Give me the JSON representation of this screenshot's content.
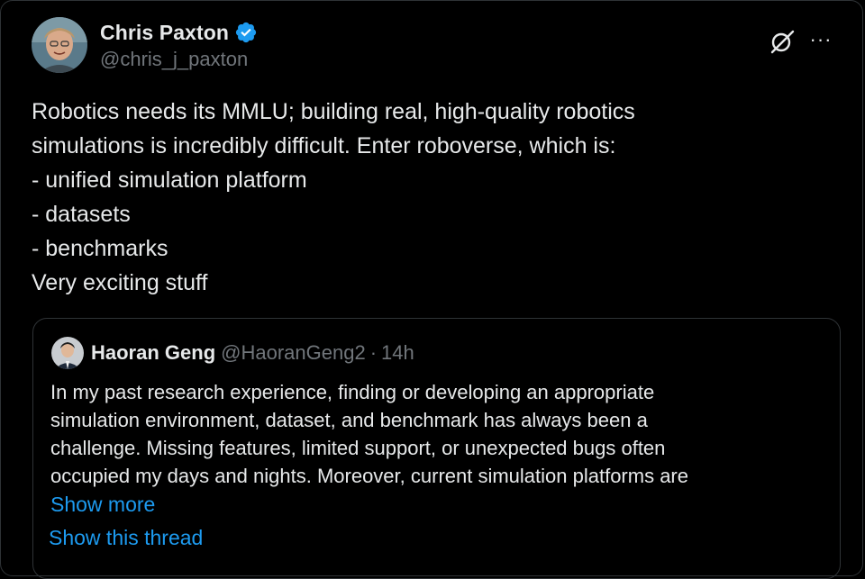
{
  "author": {
    "display_name": "Chris Paxton",
    "handle": "@chris_j_paxton",
    "avatar_icon": "avatar-photo",
    "verified_icon": "verified-badge-icon"
  },
  "actions": {
    "grok_icon": "grok-icon",
    "more_label": "···"
  },
  "tweet": {
    "lines": [
      "Robotics needs its MMLU; building real, high-quality robotics",
      "simulations is incredibly difficult. Enter roboverse, which is:",
      "- unified simulation platform",
      "- datasets",
      "- benchmarks",
      "Very exciting stuff"
    ]
  },
  "quote": {
    "display_name": "Haoran Geng",
    "handle": "@HaoranGeng2",
    "separator": "·",
    "time": "14h",
    "lines": [
      "In my past research experience, finding or developing an appropriate",
      "simulation environment, dataset, and benchmark has always been a",
      "challenge. Missing features, limited support, or unexpected bugs often",
      "occupied my days and nights. Moreover, current simulation platforms are"
    ],
    "show_more_label": "Show more"
  },
  "show_thread_label": "Show this thread",
  "colors": {
    "background": "#000000",
    "text": "#e7e9ea",
    "secondary": "#71767b",
    "link": "#1d9bf0",
    "border": "#2f3336",
    "verified": "#1d9bf0"
  }
}
